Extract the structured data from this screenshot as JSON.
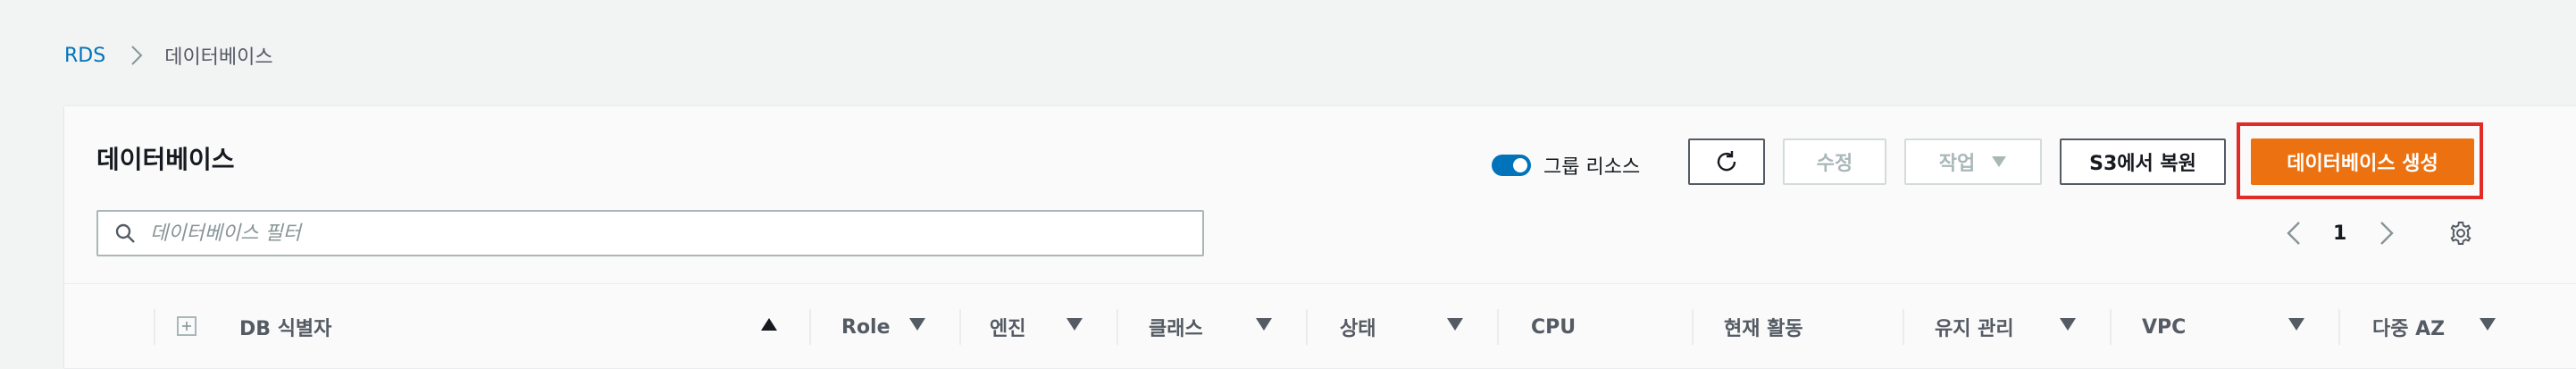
{
  "breadcrumb": {
    "root": "RDS",
    "current": "데이터베이스"
  },
  "panel": {
    "title": "데이터베이스"
  },
  "toolbar": {
    "group_toggle_label": "그룹 리소스",
    "group_toggle_on": true,
    "refresh_icon": "refresh-icon",
    "modify_label": "수정",
    "actions_label": "작업",
    "restore_s3_label": "S3에서 복원",
    "create_label": "데이터베이스 생성"
  },
  "filter": {
    "placeholder": "데이터베이스 필터",
    "value": ""
  },
  "pagination": {
    "current_page": "1"
  },
  "table": {
    "columns": [
      "DB 식별자",
      "Role",
      "엔진",
      "클래스",
      "상태",
      "CPU",
      "현재 활동",
      "유지 관리",
      "VPC",
      "다중 AZ"
    ],
    "sorted_column": "DB 식별자",
    "sort_direction": "ascending"
  },
  "colors": {
    "link": "#0073bb",
    "primary_button": "#ec7211",
    "highlight_box": "#e22b27",
    "toggle_on": "#0073bb"
  }
}
